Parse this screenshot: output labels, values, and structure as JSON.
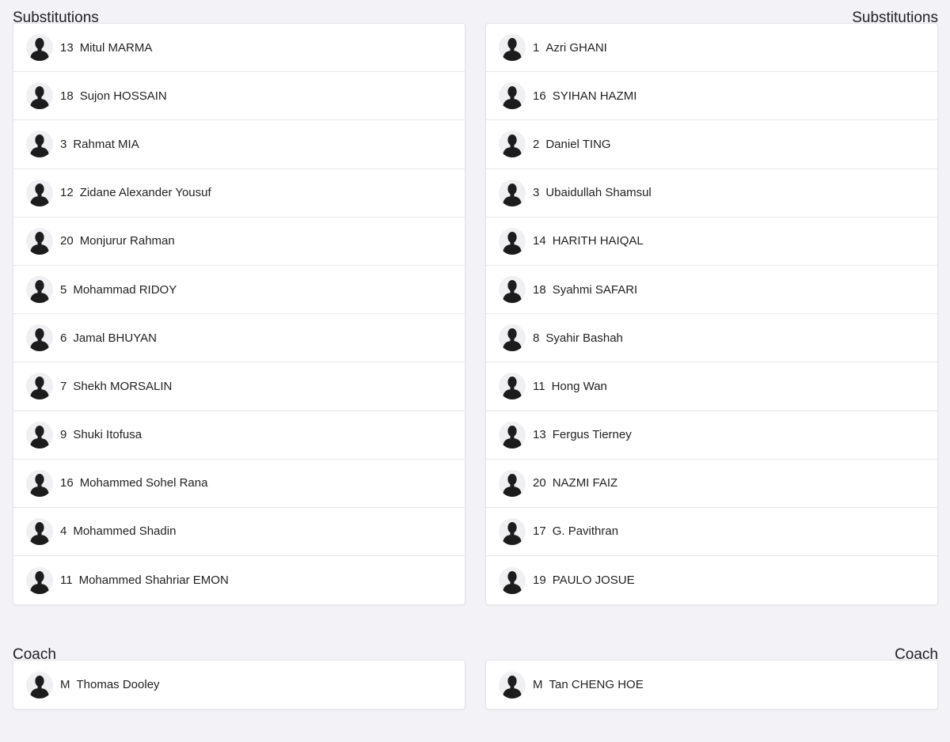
{
  "left": {
    "substitutions_title": "Substitutions",
    "substitutions": [
      {
        "number": "13",
        "name": "Mitul MARMA"
      },
      {
        "number": "18",
        "name": "Sujon HOSSAIN"
      },
      {
        "number": "3",
        "name": "Rahmat MIA"
      },
      {
        "number": "12",
        "name": "Zidane Alexander Yousuf"
      },
      {
        "number": "20",
        "name": "Monjurur Rahman"
      },
      {
        "number": "5",
        "name": "Mohammad RIDOY"
      },
      {
        "number": "6",
        "name": "Jamal BHUYAN"
      },
      {
        "number": "7",
        "name": "Shekh MORSALIN"
      },
      {
        "number": "9",
        "name": "Shuki Itofusa"
      },
      {
        "number": "16",
        "name": "Mohammed Sohel Rana"
      },
      {
        "number": "4",
        "name": "Mohammed Shadin"
      },
      {
        "number": "11",
        "name": "Mohammed Shahriar EMON"
      }
    ],
    "coach_title": "Coach",
    "coach": {
      "number": "M",
      "name": "Thomas Dooley"
    }
  },
  "right": {
    "substitutions_title": "Substitutions",
    "substitutions": [
      {
        "number": "1",
        "name": "Azri GHANI"
      },
      {
        "number": "16",
        "name": "SYIHAN HAZMI"
      },
      {
        "number": "2",
        "name": "Daniel TING"
      },
      {
        "number": "3",
        "name": "Ubaidullah Shamsul"
      },
      {
        "number": "14",
        "name": "HARITH HAIQAL"
      },
      {
        "number": "18",
        "name": "Syahmi SAFARI"
      },
      {
        "number": "8",
        "name": "Syahir Bashah"
      },
      {
        "number": "11",
        "name": "Hong Wan"
      },
      {
        "number": "13",
        "name": "Fergus Tierney"
      },
      {
        "number": "20",
        "name": "NAZMI FAIZ"
      },
      {
        "number": "17",
        "name": "G. Pavithran"
      },
      {
        "number": "19",
        "name": "PAULO JOSUE"
      }
    ],
    "coach_title": "Coach",
    "coach": {
      "number": "M",
      "name": "Tan CHENG HOE"
    }
  },
  "icons": {
    "avatar": "person-silhouette-icon"
  }
}
